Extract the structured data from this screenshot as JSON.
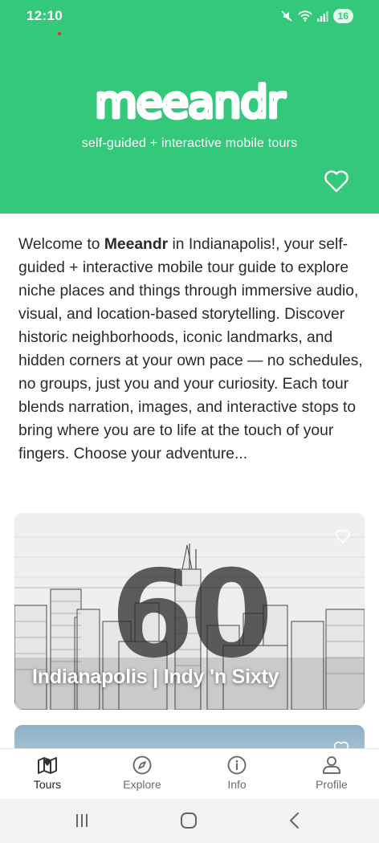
{
  "status_bar": {
    "time": "12:10",
    "battery": "16"
  },
  "header": {
    "logo_text": "meeandr",
    "tagline": "self-guided + interactive mobile tours",
    "background_color": "#34c97a"
  },
  "intro": {
    "lead": "Welcome to ",
    "brand": "Meeandr",
    "body": " in Indianapolis!, your self-guided + interactive mobile tour guide to explore niche places and things through immersive audio, visual, and location-based storytelling. Discover historic neighborhoods, iconic landmarks, and hidden corners at your own pace — no schedules, no groups, just you and your curiosity. Each tour blends narration, images, and interactive stops to bring where you are to life at the touch of your fingers. Choose your adventure..."
  },
  "tours": [
    {
      "title": "Indianapolis | Indy 'n Sixty",
      "art_text": "60"
    }
  ],
  "bottom_nav": [
    {
      "label": "Tours",
      "icon": "map-icon",
      "active": true
    },
    {
      "label": "Explore",
      "icon": "compass-icon",
      "active": false
    },
    {
      "label": "Info",
      "icon": "info-icon",
      "active": false
    },
    {
      "label": "Profile",
      "icon": "person-icon",
      "active": false
    }
  ],
  "system_nav": {
    "recents": "recents-icon",
    "home": "home-icon",
    "back": "back-icon"
  }
}
